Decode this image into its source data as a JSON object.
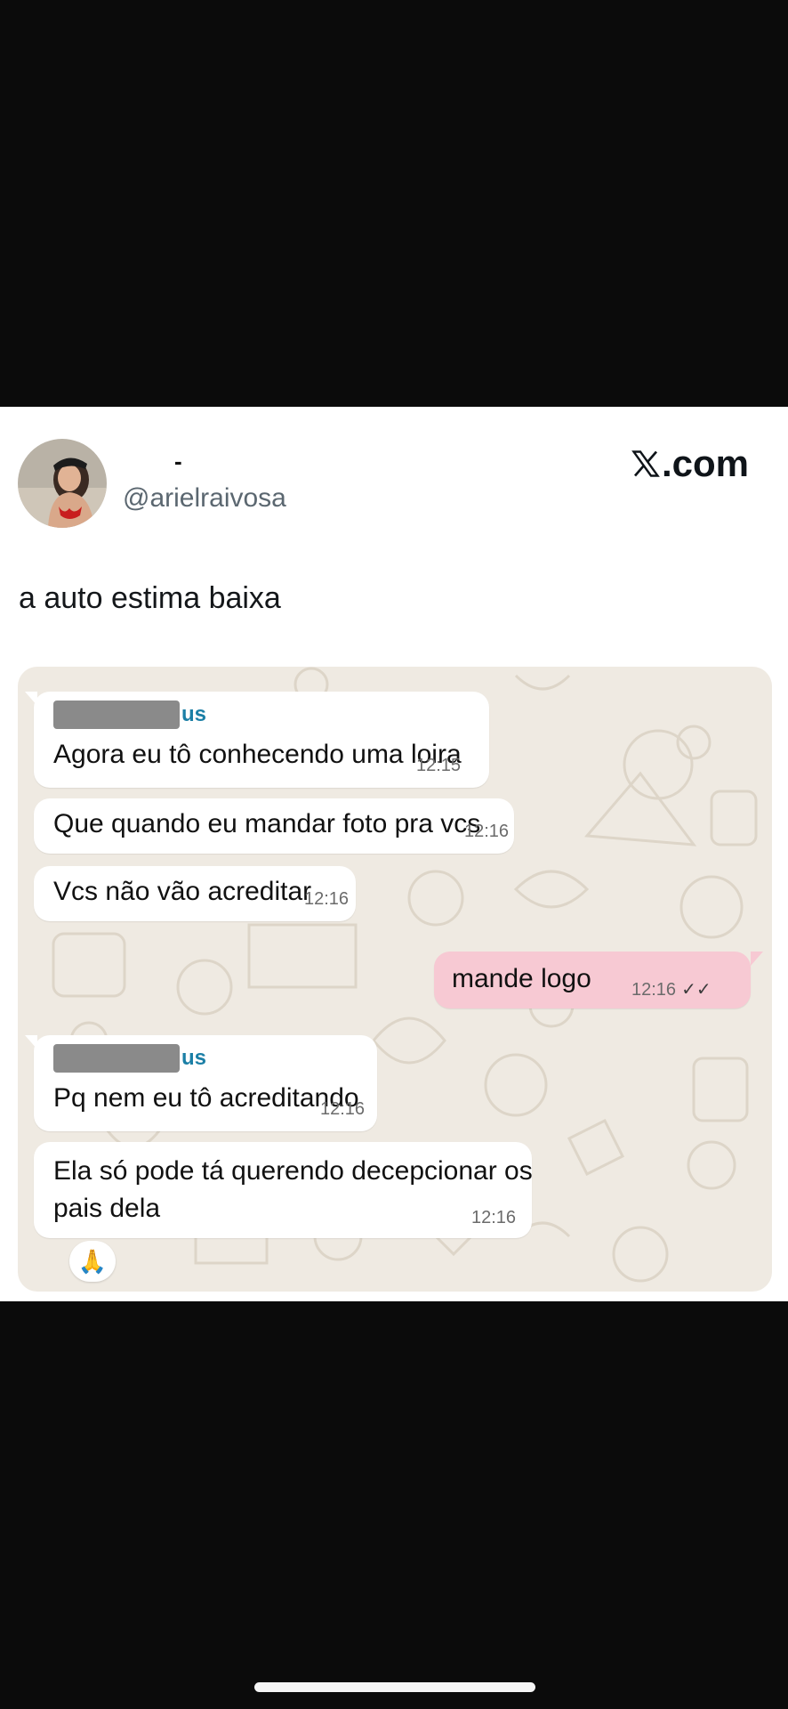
{
  "tweet": {
    "display_name": "-",
    "handle": "@arielraivosa",
    "brand": ".com",
    "text": "a auto estima baixa"
  },
  "chat": {
    "messages": [
      {
        "sender_suffix": "us",
        "text": "Agora eu tô conhecendo uma loira",
        "time": "12:15"
      },
      {
        "text": "Que quando eu mandar foto pra vcs",
        "time": "12:16"
      },
      {
        "text": "Vcs não vão acreditar",
        "time": "12:16"
      },
      {
        "text": "mande logo",
        "time": "12:16",
        "ticks": "✓✓"
      },
      {
        "sender_suffix": "us",
        "text": "Pq nem eu tô acreditando",
        "time": "12:16"
      },
      {
        "text_line1": "Ela só pode tá querendo decepcionar os",
        "text_line2": "pais dela",
        "time": "12:16"
      }
    ],
    "reaction": "🙏"
  },
  "colors": {
    "chat_background": "#efeae2",
    "incoming_bubble": "#ffffff",
    "outgoing_bubble": "#f7c9d3",
    "sender_name": "#1b7fa6"
  }
}
